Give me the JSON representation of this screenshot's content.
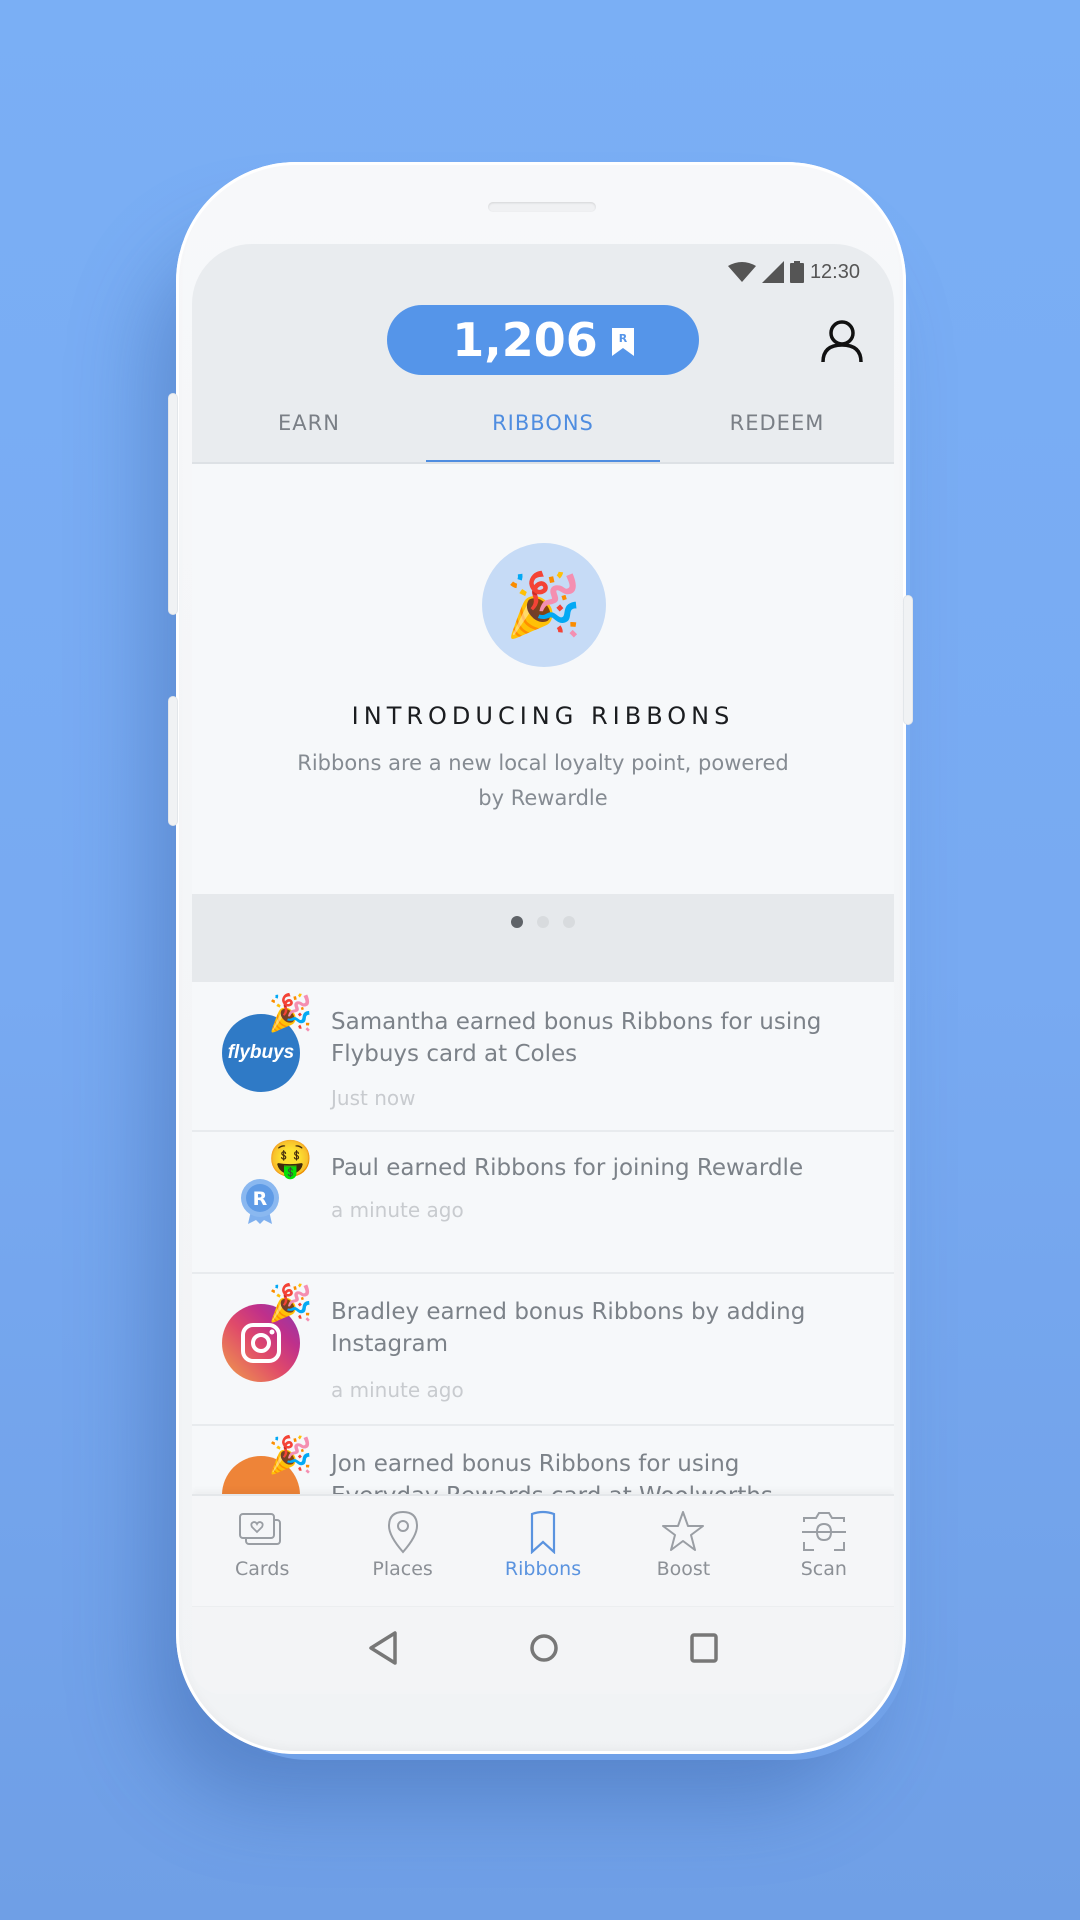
{
  "status_bar": {
    "time": "12:30",
    "icons": [
      "wifi-icon",
      "signal-icon",
      "battery-icon"
    ]
  },
  "header": {
    "points_value": "1,206",
    "points_icon": "ribbon-r-icon",
    "profile_icon": "user-icon"
  },
  "tabs": [
    {
      "label": "EARN",
      "active": false
    },
    {
      "label": "RIBBONS",
      "active": true
    },
    {
      "label": "REDEEM",
      "active": false
    }
  ],
  "hero": {
    "icon": "party-popper-icon",
    "emoji": "🎉",
    "title": "INTRODUCING RIBBONS",
    "description": "Ribbons are a new local loyalty point, powered by Rewardle"
  },
  "carousel": {
    "total_pages": 3,
    "active_page": 1
  },
  "feed": [
    {
      "avatar": "flybuys-logo",
      "avatar_label": "flybuys",
      "badge_emoji": "🎉",
      "text": "Samantha earned bonus Ribbons for using Flybuys card at Coles",
      "time": "Just now"
    },
    {
      "avatar": "rewardle-ribbon-badge",
      "avatar_label": "R",
      "badge_emoji": "🤑",
      "text": "Paul earned Ribbons for joining Rewardle",
      "time": "a minute ago"
    },
    {
      "avatar": "instagram-logo",
      "avatar_label": "",
      "badge_emoji": "🎉",
      "text": "Bradley earned bonus Ribbons by adding Instagram",
      "time": "a minute ago"
    },
    {
      "avatar": "everyday-rewards-logo",
      "avatar_label": "",
      "badge_emoji": "🎉",
      "text": "Jon earned bonus Ribbons for using Everyday Rewards card at Woolworths",
      "time": ""
    }
  ],
  "bottom_nav": [
    {
      "label": "Cards",
      "icon": "cards-icon",
      "active": false
    },
    {
      "label": "Places",
      "icon": "location-pin-icon",
      "active": false
    },
    {
      "label": "Ribbons",
      "icon": "bookmark-ribbon-icon",
      "active": true
    },
    {
      "label": "Boost",
      "icon": "star-icon",
      "active": false
    },
    {
      "label": "Scan",
      "icon": "scan-camera-icon",
      "active": false
    }
  ],
  "system_nav": [
    "back-icon",
    "home-icon",
    "recents-icon"
  ],
  "colors": {
    "accent": "#5595e9",
    "background": "#78aaf2",
    "active_tab": "#4f8de0"
  }
}
